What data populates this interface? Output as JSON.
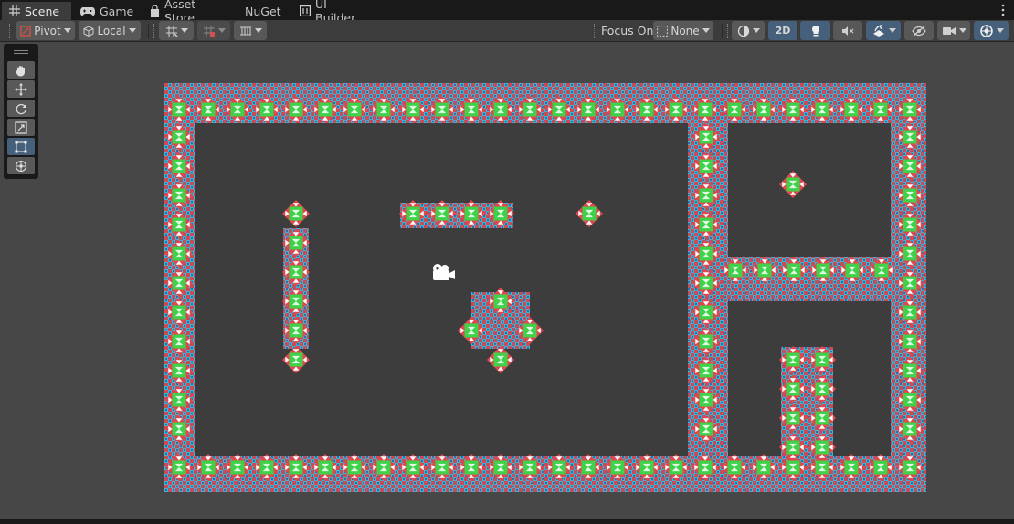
{
  "tabs": [
    {
      "label": "Scene",
      "icon": "grid-icon",
      "active": true
    },
    {
      "label": "Game",
      "icon": "gamepad-icon"
    },
    {
      "label": "Asset Store",
      "icon": "shopping-bag-icon"
    },
    {
      "label": "NuGet",
      "icon": ""
    },
    {
      "label": "UI Builder",
      "icon": "ui-builder-icon"
    }
  ],
  "toolbar": {
    "pivot_label": "Pivot",
    "local_label": "Local",
    "focus_on_label": "Focus On",
    "focus_on_value": "None",
    "two_d_label": "2D"
  },
  "tools_panel": {
    "tools": [
      "hand-tool",
      "move-tool",
      "rotate-tool",
      "scale-tool",
      "rect-tool",
      "transform-tool"
    ],
    "active_tool": "rect-tool"
  },
  "colors": {
    "scene_bg": "#474747",
    "interior": "#3d3d3d",
    "red": "#e0484e",
    "green": "#3fd14a",
    "white": "#ffffff",
    "checker_blue": "#3fb3d4",
    "checker_red": "#c84b5a",
    "active_button": "#46607c"
  },
  "icons": {
    "kebab": "kebab-menu-icon",
    "lighting": "lightbulb-icon",
    "audio": "audio-mute-icon",
    "effects": "effects-icon",
    "visibility": "hidden-eye-icon",
    "camera": "scene-camera-icon",
    "gizmos": "gizmos-icon",
    "shading": "shading-mode-icon",
    "game_camera": "camera-gizmo-icon"
  }
}
